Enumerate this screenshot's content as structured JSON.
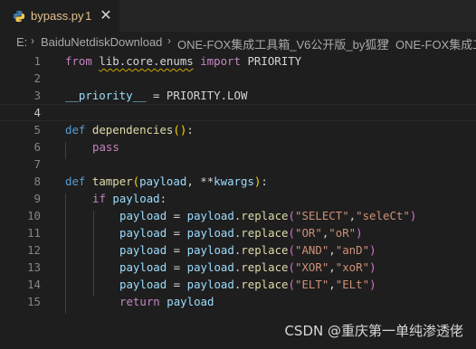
{
  "tab": {
    "filename": "bypass.py",
    "badge": "1",
    "close_glyph": "✕",
    "icon": "python-icon"
  },
  "breadcrumb": {
    "items": [
      "E:",
      "BaiduNetdiskDownload",
      "ONE-FOX集成工具箱_V6公开版_by狐狸",
      "ONE-FOX集成工"
    ],
    "separator": "›"
  },
  "editor": {
    "current_line": 4,
    "line_numbers": [
      "1",
      "2",
      "3",
      "4",
      "5",
      "6",
      "7",
      "8",
      "9",
      "10",
      "11",
      "12",
      "13",
      "14",
      "15"
    ],
    "lines": {
      "l1": {
        "kw": "from",
        "mod": "lib.core.enums",
        "kw2": "import",
        "name": "PRIORITY"
      },
      "l3": {
        "var": "__priority__",
        "eq": " = ",
        "rhs": "PRIORITY.LOW"
      },
      "l5": {
        "kw": "def",
        "fn": "dependencies",
        "open": "(",
        "close": ")",
        "colon": ":"
      },
      "l6": {
        "kw": "pass"
      },
      "l8": {
        "kw": "def",
        "fn": "tamper",
        "open": "(",
        "p1": "payload",
        "sep": ", ",
        "stars": "**",
        "p2": "kwargs",
        "close": ")",
        "colon": ":"
      },
      "l9": {
        "kw": "if",
        "var": "payload",
        "colon": ":"
      },
      "replace_lines": [
        {
          "arg1": "\"SELECT\"",
          "arg2": "\"seleCt\""
        },
        {
          "arg1": "\"OR\"",
          "arg2": "\"oR\""
        },
        {
          "arg1": "\"AND\"",
          "arg2": "\"anD\""
        },
        {
          "arg1": "\"XOR\"",
          "arg2": "\"xoR\""
        },
        {
          "arg1": "\"ELT\"",
          "arg2": "\"ELt\""
        }
      ],
      "replace_parts": {
        "lhs": "payload",
        "eq": " = ",
        "obj": "payload",
        "dot": ".",
        "method": "replace",
        "open": "(",
        "comma": ",",
        "close": ")"
      },
      "l15": {
        "kw": "return",
        "var": "payload"
      }
    }
  },
  "watermark": "CSDN @重庆第一单纯渗透佬",
  "colors": {
    "background": "#1e1e1e",
    "keyword": "#569cd6",
    "control": "#c586c0",
    "function": "#dcdcaa",
    "variable": "#9cdcfe",
    "string": "#ce9178",
    "warning_squiggle": "#cca700",
    "tab_modified": "#e2c08d"
  }
}
